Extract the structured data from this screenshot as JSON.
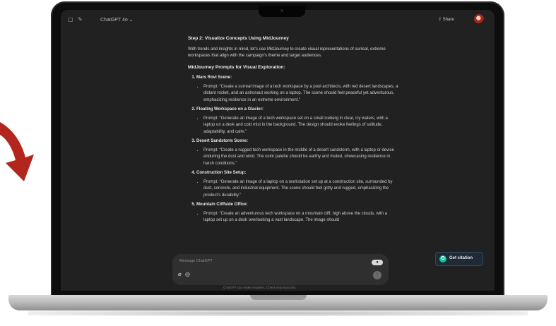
{
  "app": {
    "model_label": "ChatGPT 4o",
    "share_label": "Share"
  },
  "chat": {
    "heading": "Step 2: Visualize Concepts Using MidJourney",
    "intro": "With trends and insights in mind, let’s use MidJourney to create visual representations of surreal, extreme workspaces that align with the campaign’s theme and target audiences.",
    "subheading": "MidJourney Prompts for Visual Exploration:",
    "items": [
      {
        "title": "Mars Rovi Scene:",
        "prompt": "Prompt: “Create a surreal image of a tech workspace by a pool architects, with red desert landscapes, a distant rocket, and an astronaut working on a laptop. The scene should feel peaceful yet adventurous, emphasizing resilience in an extreme environment.”"
      },
      {
        "title": "Floating Workspace on a Glacier:",
        "prompt": "Prompt: “Generate an image of a tech workspace set on a small iceberg in clear, icy waters, with a laptop on a desk and cold mist in the background. The design should evoke feelings of solitude, adaptability, and calm.”"
      },
      {
        "title": "Desert Sandstorm Scene:",
        "prompt": "Prompt: “Create a rugged tech workspace in the middle of a desert sandstorm, with a laptop or device enduring the dust and wind. The color palette should be earthy and muted, showcasing resilience in harsh conditions.”"
      },
      {
        "title": "Construction Site Setup:",
        "prompt": "Prompt: “Generate an image of a laptop on a workstation set up at a construction site, surrounded by dust, concrete, and industrial equipment. The scene should feel gritty and rugged, emphasizing the product’s durability.”"
      },
      {
        "title": "Mountain Cliffside Office:",
        "prompt": "Prompt: “Create an adventurous tech workspace on a mountain cliff, high above the clouds, with a laptop set up on a desk overlooking a vast landscape. The image should"
      }
    ]
  },
  "composer": {
    "placeholder": "Message ChatGPT",
    "disclaimer": "ChatGPT can make mistakes. Check important info."
  },
  "grammarly": {
    "label": "Get citation"
  },
  "colors": {
    "screen_bg": "#212121",
    "composer_bg": "#2f2f2f",
    "arrow": "#b3261e",
    "grammarly_green": "#15c39a"
  }
}
